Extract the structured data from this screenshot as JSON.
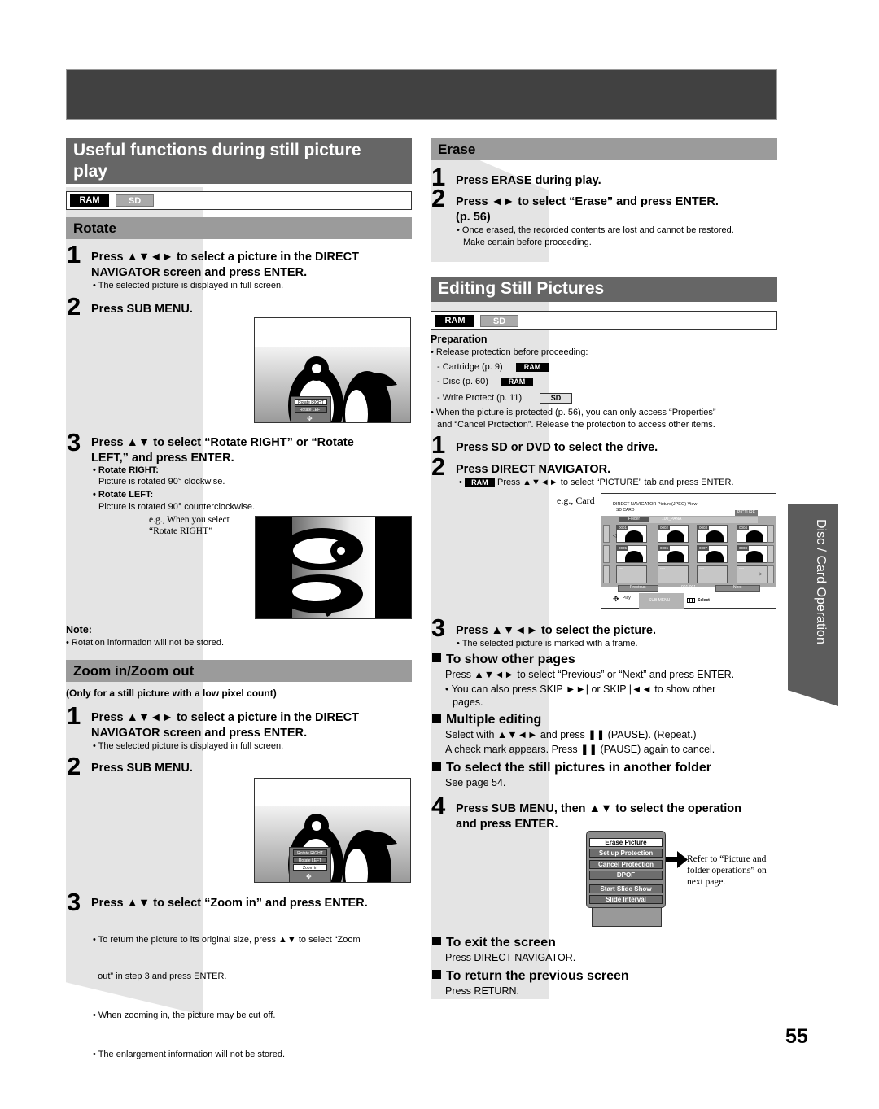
{
  "page": {
    "number": "55"
  },
  "side_tab": {
    "label": "Disc / Card Operation"
  },
  "left": {
    "title": "Useful functions during still picture play",
    "title_line1": "Useful functions during still picture",
    "title_line2": "play",
    "media": {
      "ram": "RAM",
      "sd": "SD"
    },
    "rotate": {
      "heading": "Rotate",
      "step1_num": "1",
      "step1_line1": "Press ▲▼◄► to select a picture in the DIRECT",
      "step1_line2": "NAVIGATOR screen and press ENTER.",
      "step1_note": "• The selected picture is displayed in full screen.",
      "step2_num": "2",
      "step2": "Press SUB MENU.",
      "screen_menu": [
        "Rotate RIGHT",
        "Rotate LEFT"
      ],
      "step3_num": "3",
      "step3_line1": "Press ▲▼ to select “Rotate RIGHT” or “Rotate",
      "step3_line2": "LEFT,” and press ENTER.",
      "right_label": "• Rotate RIGHT:",
      "right_desc": "Picture is rotated 90° clockwise.",
      "left_label": "• Rotate LEFT:",
      "left_desc": "Picture is rotated 90° counterclockwise.",
      "example_line1": "e.g., When you select",
      "example_line2": "“Rotate RIGHT”",
      "note_title": "Note:",
      "note_text": "• Rotation information will not be stored."
    },
    "zoom": {
      "heading": "Zoom in/Zoom out",
      "subtitle": "(Only for a still picture with a low pixel count)",
      "step1_num": "1",
      "step1_line1": "Press ▲▼◄► to select a picture in the DIRECT",
      "step1_line2": "NAVIGATOR screen and press ENTER.",
      "step1_note": "• The selected picture is displayed in full screen.",
      "step2_num": "2",
      "step2": "Press SUB MENU.",
      "screen_menu": [
        "Rotate RIGHT",
        "Rotate LEFT",
        "Zoom in"
      ],
      "step3_num": "3",
      "step3": "Press ▲▼ to select “Zoom in” and press ENTER.",
      "notes": [
        "• To return the picture to its original size, press ▲▼ to select “Zoom",
        "  out” in step 3 and press ENTER.",
        "• When zooming in, the picture may be cut off.",
        "• The enlargement information will not be stored."
      ]
    }
  },
  "right": {
    "erase": {
      "heading": "Erase",
      "step1_num": "1",
      "step1": "Press ERASE during play.",
      "step2_num": "2",
      "step2_line1": "Press ◄► to select “Erase” and press ENTER.",
      "step2_line2": "(p. 56)",
      "note_line1": "• Once erased, the recorded contents are lost and cannot be restored.",
      "note_line2": "Make certain before proceeding."
    },
    "editing": {
      "heading": "Editing Still Pictures",
      "media": {
        "ram": "RAM",
        "sd": "SD"
      },
      "prep_title": "Preparation",
      "prep_intro": "• Release protection before proceeding:",
      "prep_items": [
        {
          "text": "- Cartridge (p. 9)",
          "badge": "RAM"
        },
        {
          "text": "- Disc (p. 60)",
          "badge": "RAM"
        },
        {
          "text": "- Write Protect (p. 11)",
          "badge": "SD"
        }
      ],
      "prep_note_line1": "• When the picture is protected (p. 56), you can only access “Properties”",
      "prep_note_line2": "and “Cancel Protection”. Release the protection to access other items.",
      "step1_num": "1",
      "step1": "Press SD or DVD to select the drive.",
      "step2_num": "2",
      "step2": "Press DIRECT NAVIGATOR.",
      "step2_note_badge": "RAM",
      "step2_note": "Press ▲▼◄► to select “PICTURE” tab and press ENTER.",
      "example": "e.g., Card",
      "navigator": {
        "title": "DIRECT NAVIGATOR   Picture(JPEG) View",
        "drive": "SD CARD",
        "tab": "PICTURE",
        "folder_label": "Folder",
        "folder_name": "100_PANA",
        "thumbs": [
          "0001",
          "0002",
          "0003",
          "0004",
          "0005",
          "0006",
          "0007",
          "0008"
        ],
        "empty": [
          "----",
          "----",
          "----",
          "----"
        ],
        "previous": "Previous",
        "page": "001/001",
        "next": "Next",
        "play": "Play",
        "submenu": "SUB MENU",
        "select": "Select"
      },
      "step3_num": "3",
      "step3": "Press ▲▼◄► to select the picture.",
      "step3_note": "• The selected picture is marked with a frame.",
      "show_pages_title": "To show other pages",
      "show_pages_text": "Press ▲▼◄► to select “Previous” or “Next” and press ENTER.",
      "show_pages_note1": "• You can also press SKIP ►►| or SKIP |◄◄ to show other",
      "show_pages_note2": "pages.",
      "multi_title": "Multiple editing",
      "multi_line1": "Select with ▲▼◄► and press ❚❚ (PAUSE). (Repeat.)",
      "multi_line2": "A check mark appears. Press ❚❚ (PAUSE) again to cancel.",
      "folder_title": "To select the still pictures in another folder",
      "folder_text": "See page 54.",
      "step4_num": "4",
      "step4_line1": "Press SUB MENU, then ▲▼ to select the operation",
      "step4_line2": "and press ENTER.",
      "submenu_items": [
        "Erase Picture",
        "Set up Protection",
        "Cancel Protection",
        "DPOF",
        "Start Slide Show",
        "Slide Interval"
      ],
      "refer_line1": "Refer to “Picture and",
      "refer_line2": "folder operations” on",
      "refer_line3": "next page.",
      "exit_title": "To exit the screen",
      "exit_text": "Press DIRECT NAVIGATOR.",
      "return_title": "To return the previous screen",
      "return_text": "Press RETURN."
    }
  }
}
